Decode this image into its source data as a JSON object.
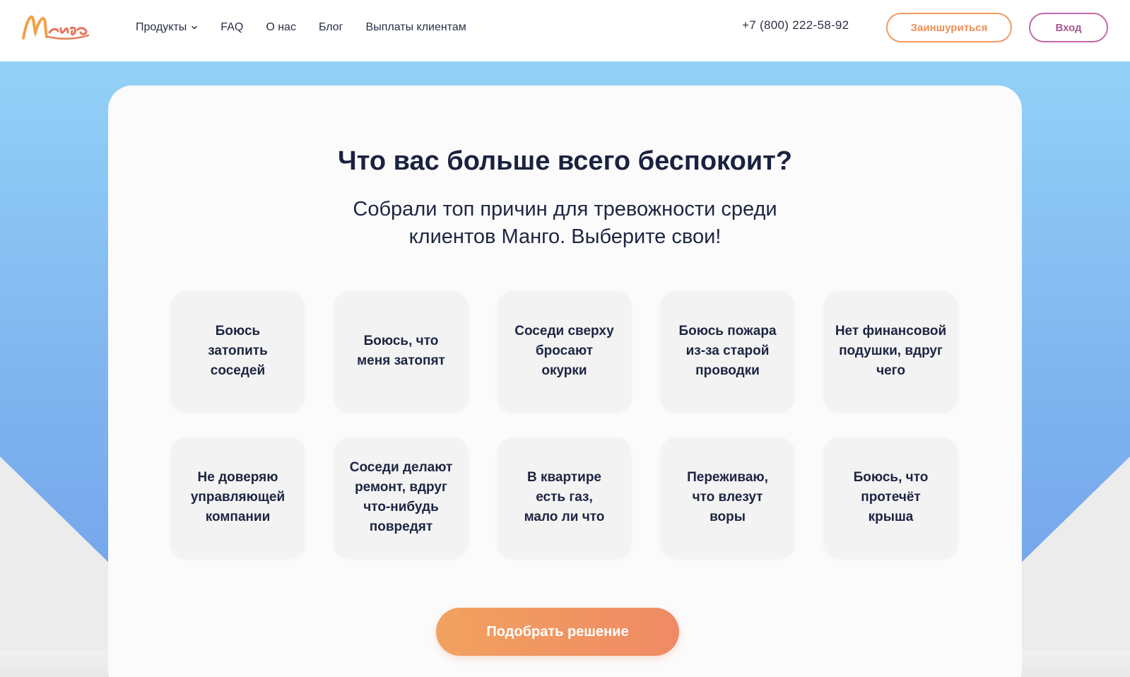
{
  "header": {
    "logo_text": "Манго",
    "nav": [
      {
        "label": "Продукты",
        "has_dropdown": true
      },
      {
        "label": "FAQ"
      },
      {
        "label": "О нас"
      },
      {
        "label": "Блог"
      },
      {
        "label": "Выплаты клиентам"
      }
    ],
    "phone": "+7 (800) 222-58-92",
    "insure_label": "Заиншуриться",
    "login_label": "Вход"
  },
  "main": {
    "title": "Что вас больше всего беспокоит?",
    "subtitle_line1": "Собрали топ причин для тревожности среди",
    "subtitle_line2": "клиентов Манго. Выберите свои!",
    "options": [
      "Боюсь\nзатопить\nсоседей",
      "Боюсь, что\nменя затопят",
      "Соседи сверху\nбросают\nокурки",
      "Боюсь пожара\nиз-за старой\nпроводки",
      "Нет финансовой\nподушки, вдруг\nчего",
      "Не доверяю\nуправляющей\nкомпании",
      "Соседи делают\nремонт, вдруг\nчто-нибудь\nповредят",
      "В квартире\nесть газ,\nмало ли что",
      "Переживаю,\nчто влезут\nворы",
      "Боюсь, что\nпротечёт\nкрыша"
    ],
    "cta_label": "Подобрать решение"
  },
  "colors": {
    "accent_orange": "#ef8f57",
    "accent_magenta": "#a9578f",
    "bg_blue": "#82b8f0"
  }
}
